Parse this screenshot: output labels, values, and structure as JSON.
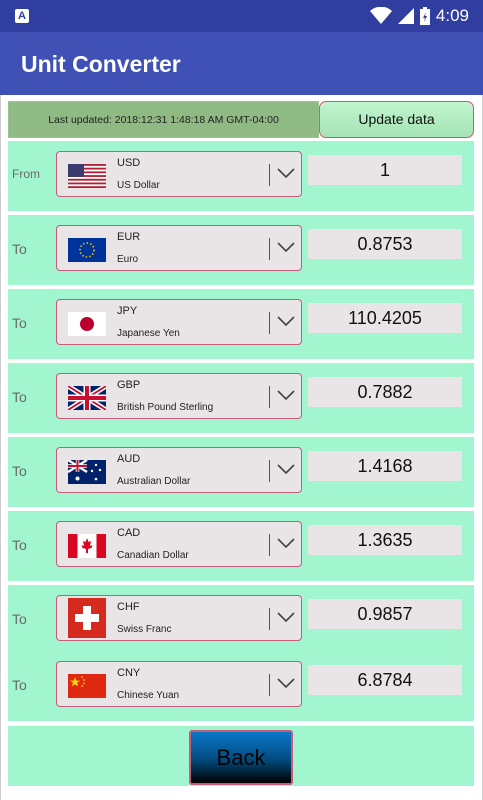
{
  "status_bar": {
    "notification_icon": "A",
    "time": "4:09"
  },
  "app": {
    "title": "Unit Converter"
  },
  "last_updated": "Last updated: 2018:12:31 1:48:18 AM GMT-04:00",
  "update_button": "Update data",
  "rows": [
    {
      "label": "From",
      "code": "USD",
      "name": "US Dollar",
      "value": "1",
      "flag_icon": "us-flag-icon"
    },
    {
      "label": "To",
      "code": "EUR",
      "name": "Euro",
      "value": "0.8753",
      "flag_icon": "eu-flag-icon"
    },
    {
      "label": "To",
      "code": "JPY",
      "name": "Japanese Yen",
      "value": "110.4205",
      "flag_icon": "jp-flag-icon"
    },
    {
      "label": "To",
      "code": "GBP",
      "name": "British Pound Sterling",
      "value": "0.7882",
      "flag_icon": "gb-flag-icon"
    },
    {
      "label": "To",
      "code": "AUD",
      "name": "Australian Dollar",
      "value": "1.4168",
      "flag_icon": "au-flag-icon"
    },
    {
      "label": "To",
      "code": "CAD",
      "name": "Canadian Dollar",
      "value": "1.3635",
      "flag_icon": "ca-flag-icon"
    },
    {
      "label": "To",
      "code": "CHF",
      "name": "Swiss Franc",
      "value": "0.9857",
      "flag_icon": "ch-flag-icon"
    },
    {
      "label": "To",
      "code": "CNY",
      "name": "Chinese Yuan",
      "value": "6.8784",
      "flag_icon": "cn-flag-icon"
    }
  ],
  "back_button": "Back",
  "colors": {
    "status_bar": "#303f9f",
    "app_bar": "#3f51b5",
    "row_background": "#a1f5cf",
    "accent_border": "#c45c7a"
  }
}
